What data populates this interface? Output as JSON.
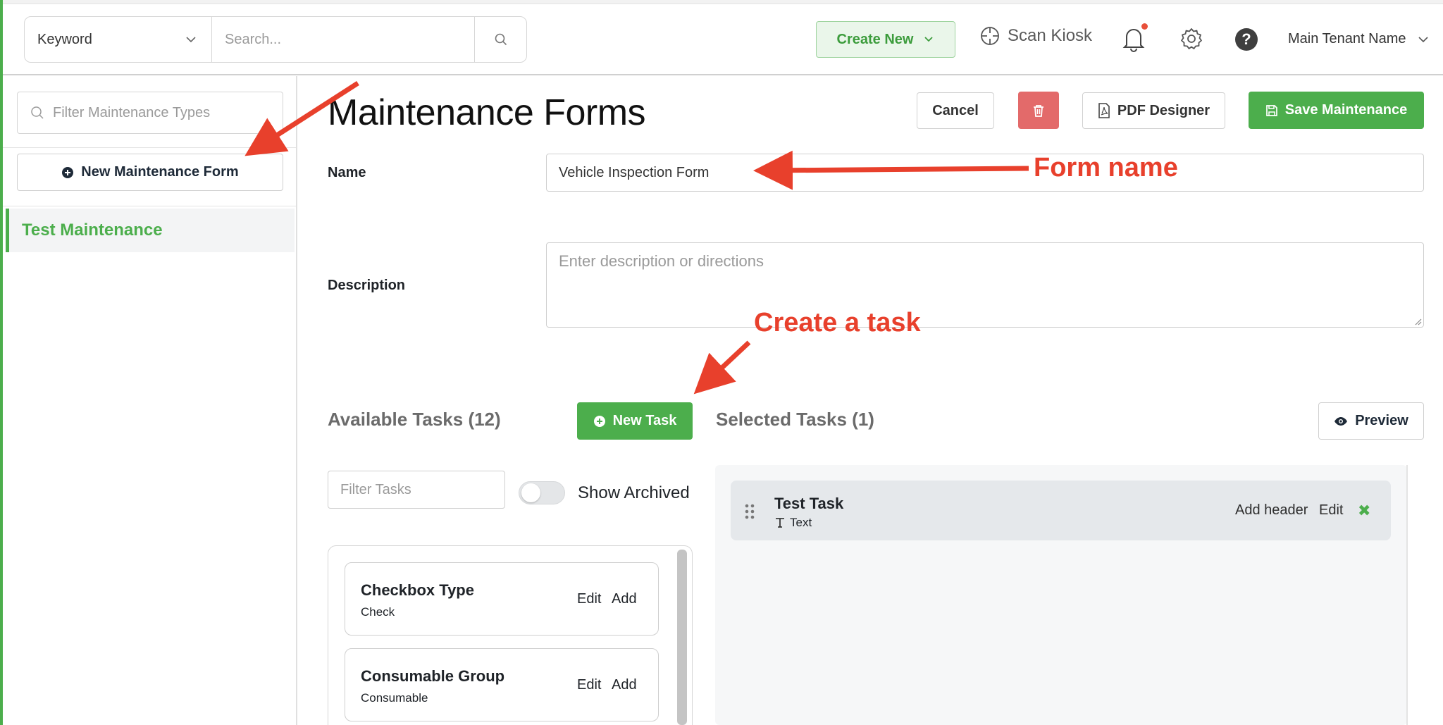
{
  "topbar": {
    "keyword_select": "Keyword",
    "search_placeholder": "Search...",
    "create_new": "Create New",
    "scan_kiosk": "Scan Kiosk",
    "tenant_name": "Main Tenant Name"
  },
  "sidebar": {
    "filter_placeholder": "Filter Maintenance Types",
    "new_form_button": "New Maintenance Form",
    "items": [
      {
        "label": "Test Maintenance",
        "active": true
      }
    ]
  },
  "main": {
    "title": "Maintenance Forms",
    "actions": {
      "cancel": "Cancel",
      "pdf_designer": "PDF Designer",
      "save": "Save Maintenance"
    },
    "form": {
      "name_label": "Name",
      "name_value": "Vehicle Inspection Form",
      "description_label": "Description",
      "description_placeholder": "Enter description or directions"
    },
    "available": {
      "heading": "Available Tasks (12)",
      "new_task_button": "New Task",
      "filter_placeholder": "Filter Tasks",
      "show_archived_label": "Show Archived",
      "show_archived_on": false,
      "edit_label": "Edit",
      "add_label": "Add",
      "tasks": [
        {
          "title": "Checkbox Type",
          "type": "Check"
        },
        {
          "title": "Consumable Group",
          "type": "Consumable"
        }
      ]
    },
    "selected": {
      "heading": "Selected Tasks (1)",
      "preview_button": "Preview",
      "tasks": [
        {
          "title": "Test Task",
          "type": "Text",
          "add_header": "Add header",
          "edit": "Edit"
        }
      ]
    }
  },
  "annotations": {
    "form_name": "Form name",
    "create_task": "Create a task",
    "color": "#e8402c"
  },
  "colors": {
    "brand_green": "#4cae4c",
    "danger": "#e36a6a",
    "notification_dot": "#e8503a"
  },
  "icons": [
    "chevron-down-icon",
    "search-icon",
    "crosshair-icon",
    "bell-icon",
    "gear-icon",
    "help-icon",
    "plus-circle-icon",
    "trash-icon",
    "pdf-icon",
    "save-icon",
    "eye-icon",
    "drag-handle-icon",
    "text-type-icon",
    "remove-icon"
  ]
}
